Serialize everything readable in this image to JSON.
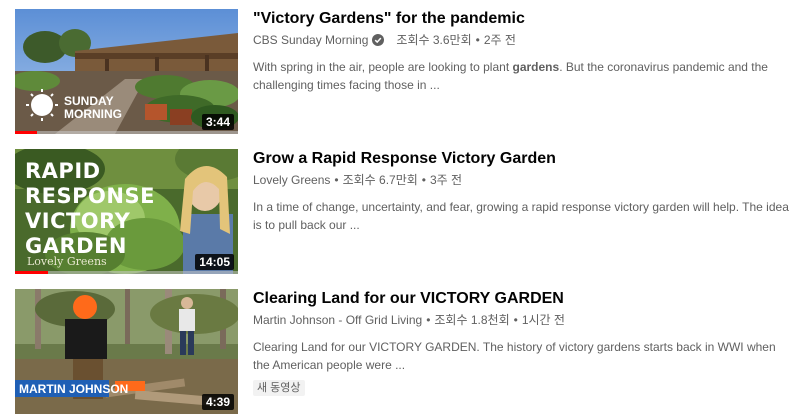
{
  "videos": [
    {
      "title": "\"Victory Gardens\" for the pandemic",
      "channel": "CBS Sunday Morning",
      "verified": true,
      "views": "조회수 3.6만회",
      "age": "2주 전",
      "desc_before": "With spring in the air, people are looking to plant ",
      "desc_bold": "gardens",
      "desc_after": ". But the coronavirus pandemic and the challenging times facing those in ...",
      "duration": "3:44",
      "progress": 0.1,
      "thumb_logo": "SUNDAY\nMORNING",
      "thumb_logo_line1": "SUNDAY",
      "thumb_logo_line2": "MORNING"
    },
    {
      "title": "Grow a Rapid Response Victory Garden",
      "channel": "Lovely Greens",
      "verified": false,
      "views": "조회수 6.7만회",
      "age": "3주 전",
      "desc": "In a time of change, uncertainty, and fear, growing a rapid response victory garden will help. The idea is to pull back our ...",
      "duration": "14:05",
      "progress": 0.15,
      "thumb_lines": [
        "RAPID",
        "RESPONSE",
        "VICTORY",
        "GARDEN"
      ],
      "thumb_watermark": "Lovely Greens"
    },
    {
      "title": "Clearing Land for our VICTORY GARDEN",
      "channel": "Martin Johnson - Off Grid Living",
      "verified": false,
      "views": "조회수 1.8천회",
      "age": "1시간 전",
      "desc": "Clearing Land for our VICTORY GARDEN. The history of victory gardens starts back in WWI when the American people were ...",
      "badge": "새 동영상",
      "duration": "4:39",
      "thumb_banner": "MARTIN JOHNSON"
    }
  ],
  "separator": "•",
  "colors": {
    "progress": "#ff0000",
    "meta_text": "#606060",
    "title_text": "#030303"
  }
}
